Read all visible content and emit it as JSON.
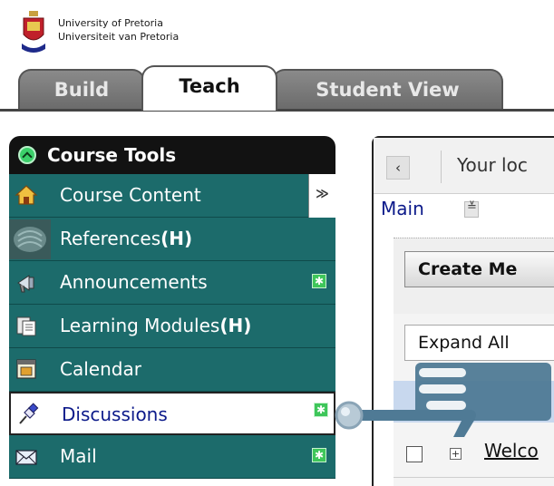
{
  "institution": {
    "line1": "University of Pretoria",
    "line2": "Universiteit van Pretoria"
  },
  "tabs": [
    {
      "label": "Build",
      "active": false
    },
    {
      "label": "Teach",
      "active": true
    },
    {
      "label": "Student View",
      "active": false
    }
  ],
  "course_tools": {
    "title": "Course Tools",
    "items": [
      {
        "label": "Course Content",
        "icon": "home-icon",
        "badge": false,
        "selected": false
      },
      {
        "label": "References",
        "suffix": "(H)",
        "icon": "book-icon",
        "badge": false,
        "selected": false
      },
      {
        "label": "Announcements",
        "icon": "megaphone-icon",
        "badge": true,
        "selected": false
      },
      {
        "label": "Learning Modules",
        "suffix": "(H)",
        "icon": "modules-icon",
        "badge": true,
        "selected": false
      },
      {
        "label": "Calendar",
        "icon": "calendar-icon",
        "badge": false,
        "selected": false
      },
      {
        "label": "Discussions",
        "icon": "pin-icon",
        "badge": true,
        "selected": true
      },
      {
        "label": "Mail",
        "icon": "mail-icon",
        "badge": true,
        "selected": false
      }
    ],
    "badge_symbol": "✱",
    "collapse_symbol": "≫"
  },
  "content": {
    "back_symbol": "‹",
    "breadcrumb": "Your loc",
    "page_title": "Main",
    "create_button": "Create Me",
    "expand_button": "Expand All",
    "row_title": "Welco",
    "expander_symbol": "+"
  },
  "colors": {
    "menu_bg": "#1c6b6b",
    "menu_header_bg": "#121212",
    "link_blue": "#0c1a8a",
    "new_badge": "#3ec65a",
    "pointer": "#4f7a95"
  }
}
